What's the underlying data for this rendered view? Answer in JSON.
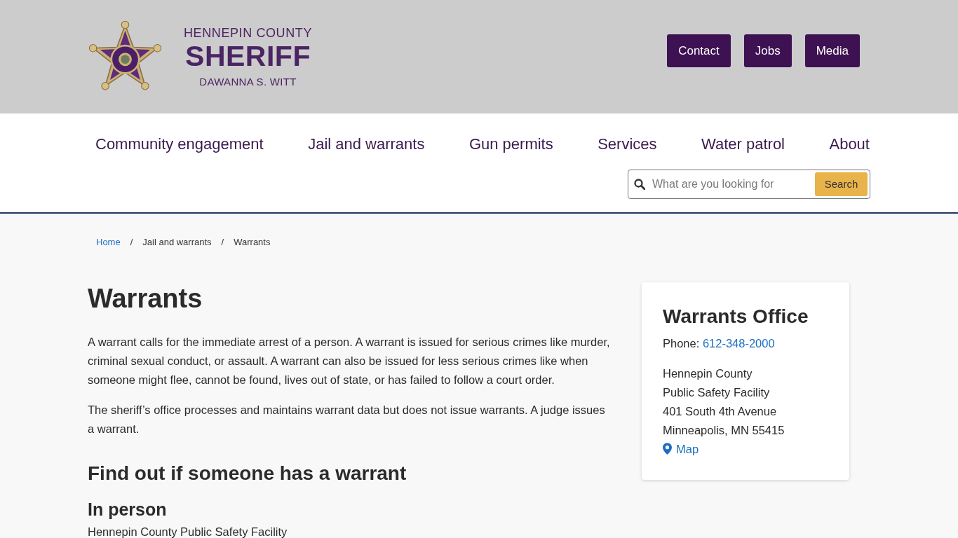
{
  "header": {
    "logo": {
      "line_1": "HENNEPIN COUNTY",
      "line_2": "SHERIFF",
      "line_3": "DAWANNA S. WITT"
    },
    "buttons": [
      "Contact",
      "Jobs",
      "Media"
    ]
  },
  "nav": {
    "items": [
      "Community engagement",
      "Jail and warrants",
      "Gun permits",
      "Services",
      "Water patrol",
      "About"
    ],
    "search": {
      "placeholder": "What are you looking for",
      "button": "Search"
    }
  },
  "breadcrumb": [
    {
      "kind": "link",
      "text": "Home"
    },
    {
      "kind": "separator",
      "text": "/"
    },
    {
      "kind": "text",
      "text": "Jail and warrants"
    },
    {
      "kind": "separator",
      "text": "/"
    },
    {
      "kind": "text",
      "text": "Warrants"
    }
  ],
  "article": [
    {
      "kind": "heading_1",
      "text": "Warrants"
    },
    {
      "kind": "paragraph",
      "text": "A warrant calls for the immediate arrest of a person. A warrant is issued for serious crimes like murder, criminal sexual conduct, or assault. A warrant can also be issued for less serious crimes like when someone might flee, cannot be found, lives out of state, or has failed to follow a court order."
    },
    {
      "kind": "paragraph",
      "text": "The sheriff’s office processes and maintains warrant data but does not issue warrants. A judge issues a warrant."
    },
    {
      "kind": "heading_2",
      "text": "Find out if someone has a warrant"
    },
    {
      "kind": "heading_3",
      "text": "In person"
    },
    {
      "kind": "paragraph",
      "text": "Hennepin County Public Safety Facility"
    }
  ],
  "sidebar_card": {
    "title": "Warrants Office",
    "phone_label": "Phone:",
    "phone": "612-348-2000",
    "address_lines": [
      "Hennepin County",
      "Public Safety Facility",
      "401 South 4th Avenue",
      "Minneapolis, MN 55415"
    ],
    "map_link": "Map"
  }
}
